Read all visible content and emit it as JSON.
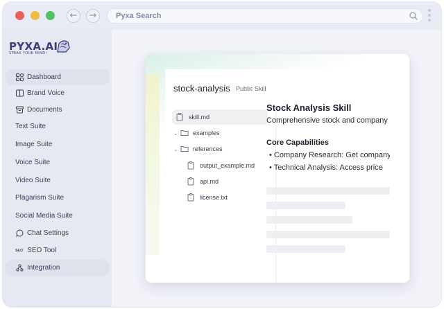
{
  "browser": {
    "url_text": "Pyxa Search",
    "back_glyph": "←",
    "forward_glyph": "→"
  },
  "brand": {
    "name": "PYXA.AI",
    "tagline": "SPEAK YOUR MIND!",
    "color": "#3b3f7a"
  },
  "sidebar": {
    "items": [
      {
        "label": "Dashboard",
        "icon": "grid-icon"
      },
      {
        "label": "Brand Voice",
        "icon": "book-icon"
      },
      {
        "label": "Documents",
        "icon": "archive-icon"
      },
      {
        "label": "Text Suite"
      },
      {
        "label": "Image Suite"
      },
      {
        "label": "Voice Suite"
      },
      {
        "label": "Video Suite"
      },
      {
        "label": "Plagarism Suite"
      },
      {
        "label": "Social Media Suite"
      },
      {
        "label": "Chat Settings",
        "icon": "chat-icon"
      },
      {
        "label": "SEO Tool",
        "icon_text": "SEO"
      },
      {
        "label": "Integration",
        "icon": "integration-icon"
      }
    ]
  },
  "skill": {
    "name": "stock-analysis",
    "badge": "Public Skill",
    "files": [
      {
        "label": "skill.md",
        "type": "file"
      },
      {
        "label": "examples",
        "type": "folder"
      },
      {
        "label": "references",
        "type": "folder"
      },
      {
        "label": "output_example.md",
        "type": "file"
      },
      {
        "label": "api.md",
        "type": "file"
      },
      {
        "label": "license.txt",
        "type": "file"
      }
    ]
  },
  "document": {
    "title": "Stock Analysis Skill",
    "intro": "Comprehensive stock and company",
    "section": "Core Capabilities",
    "bullets": [
      "• Company Research: Get company",
      "• Technical Analysis: Access price"
    ]
  },
  "colors": {
    "traffic_red": "#e9605a",
    "traffic_yellow": "#efbd3f",
    "traffic_green": "#52c161",
    "active_item_bg": "#dfe1ed"
  }
}
